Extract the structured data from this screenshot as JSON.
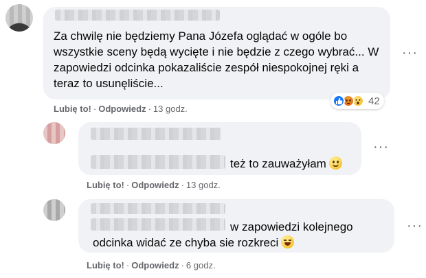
{
  "comments": [
    {
      "text": "Za chwilę nie będziemy Pana Józefa oglądać w ogóle bo wszystkie sceny będą wycięte i nie będzie z czego wybrać... W zapowiedzi odcinka pokazaliście zespół niespokojnej ręki a teraz to usunęliście...",
      "like": "Lubię to!",
      "reply": "Odpowiedz",
      "time": "13 godz.",
      "reaction_count": "42",
      "reactions": [
        "like-icon",
        "angry-icon",
        "wow-icon"
      ]
    },
    {
      "text": "też to zauważyłam",
      "emoji": "smile-emoji",
      "like": "Lubię to!",
      "reply": "Odpowiedz",
      "time": "13 godz."
    },
    {
      "text_line1": "w zapowiedzi kolejnego",
      "text_line2": "odcinka widać ze chyba sie rozkreci",
      "emoji": "laughing-emoji",
      "like": "Lubię to!",
      "reply": "Odpowiedz",
      "time": "6 godz."
    }
  ],
  "more_icon": "···",
  "dot": "·",
  "colors": {
    "bubble": "#f0f2f5",
    "meta": "#65676b",
    "like_blue": "#1877f2",
    "angry": "#e9710f",
    "wow": "#f7b125"
  }
}
